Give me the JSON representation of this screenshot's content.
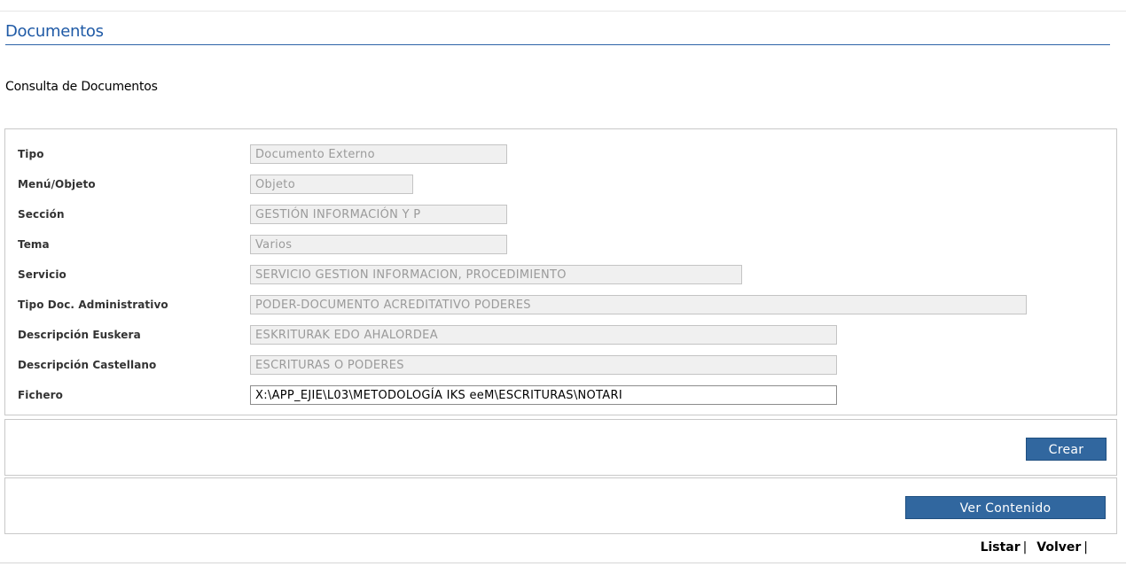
{
  "header": {
    "title": "Documentos",
    "subtitle": "Consulta de Documentos"
  },
  "form": {
    "fields": [
      {
        "label": "Tipo",
        "value": "Documento Externo"
      },
      {
        "label": "Menú/Objeto",
        "value": "Objeto"
      },
      {
        "label": "Sección",
        "value": "GESTIÓN INFORMACIÓN Y P"
      },
      {
        "label": "Tema",
        "value": "Varios"
      },
      {
        "label": "Servicio",
        "value": "SERVICIO GESTION INFORMACION, PROCEDIMIENTO"
      },
      {
        "label": "Tipo Doc. Administrativo",
        "value": "PODER-DOCUMENTO  ACREDITATIVO PODERES"
      },
      {
        "label": "Descripción Euskera",
        "value": "ESKRITURAK EDO AHALORDEA"
      },
      {
        "label": "Descripción Castellano",
        "value": "ESCRITURAS O PODERES"
      },
      {
        "label": "Fichero",
        "value": "X:\\APP_EJIE\\L03\\METODOLOGÍA IKS eeM\\ESCRITURAS\\NOTARI"
      }
    ]
  },
  "actions": {
    "crear_label": "Crear",
    "ver_contenido_label": "Ver Contenido"
  },
  "footer": {
    "listar_label": "Listar",
    "volver_label": "Volver",
    "separator": "|"
  },
  "colors": {
    "accent": "#1f5aa6",
    "button": "#31679f",
    "field_bg": "#f0f0f0",
    "field_text": "#9a9a9a"
  }
}
